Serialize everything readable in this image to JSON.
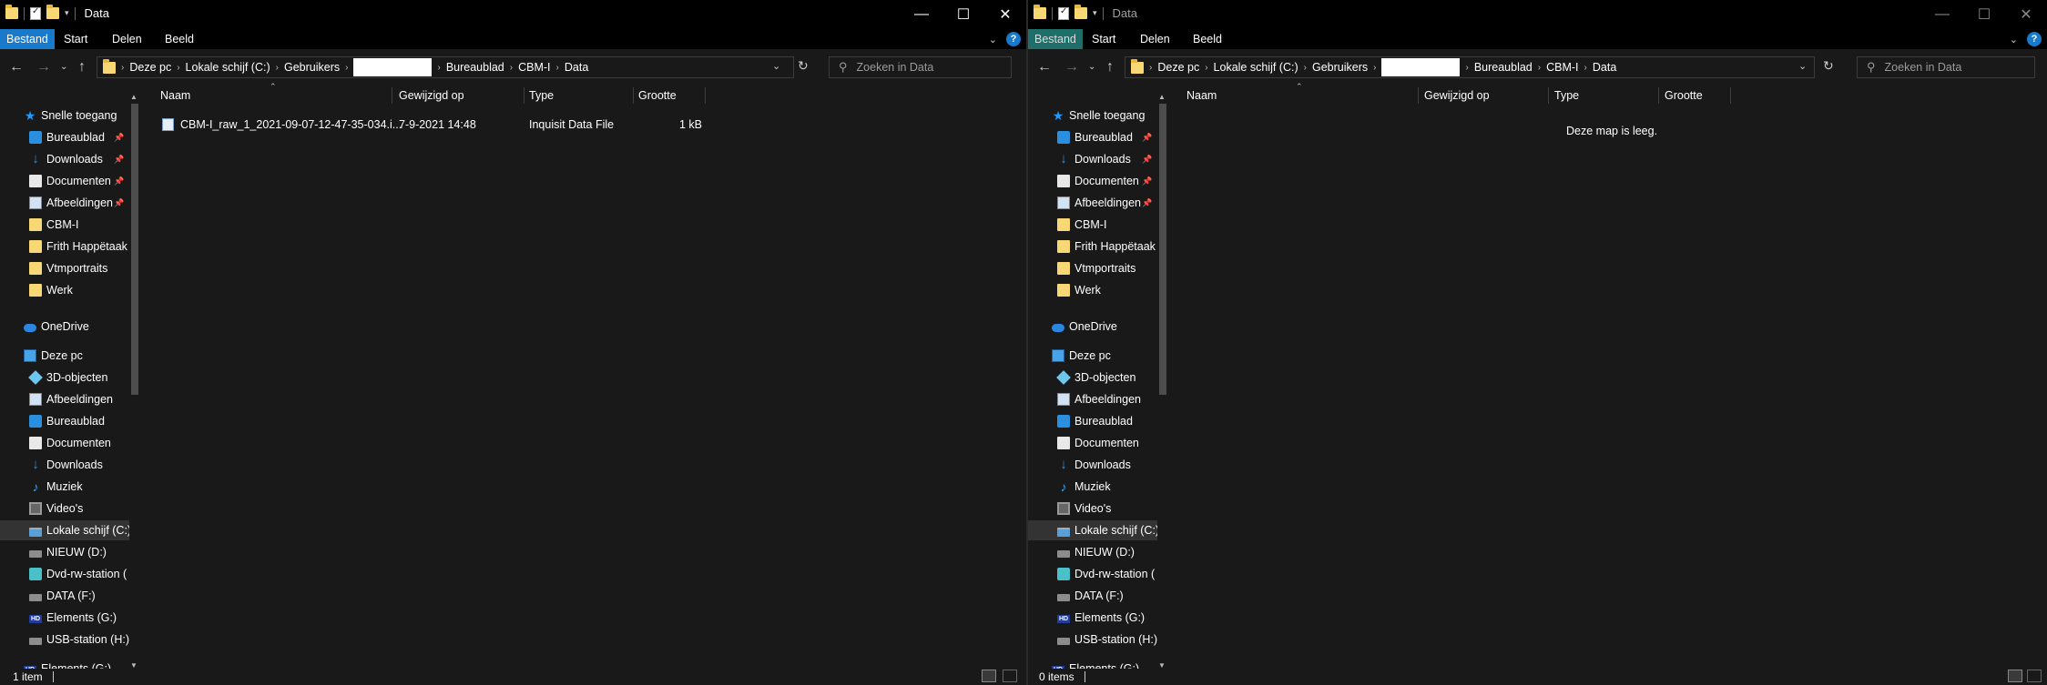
{
  "left": {
    "title": "Data",
    "ribbon_tabs": [
      "Bestand",
      "Start",
      "Delen",
      "Beeld"
    ],
    "breadcrumb": [
      "Deze pc",
      "Lokale schijf (C:)",
      "Gebruikers",
      "Bureaublad",
      "CBM-I",
      "Data"
    ],
    "search_placeholder": "Zoeken in Data",
    "nav": {
      "quick_access": "Snelle toegang",
      "quick_items": [
        "Bureaublad",
        "Downloads",
        "Documenten",
        "Afbeeldingen",
        "CBM-I",
        "Frith Happëtaak",
        "Vtmportraits",
        "Werk"
      ],
      "onedrive": "OneDrive",
      "this_pc": "Deze pc",
      "pc_items": [
        "3D-objecten",
        "Afbeeldingen",
        "Bureaublad",
        "Documenten",
        "Downloads",
        "Muziek",
        "Video's",
        "Lokale schijf (C:)",
        "NIEUW (D:)",
        "Dvd-rw-station (",
        "DATA (F:)",
        "Elements (G:)",
        "USB-station (H:)"
      ],
      "extra_item": "Elements (G:)"
    },
    "columns": [
      "Naam",
      "Gewijzigd op",
      "Type",
      "Grootte"
    ],
    "files": [
      {
        "name": "CBM-I_raw_1_2021-09-07-12-47-35-034.i...",
        "modified": "7-9-2021 14:48",
        "type": "Inquisit Data File",
        "size": "1 kB"
      }
    ],
    "status_count": "1 item"
  },
  "right": {
    "title": "Data",
    "ribbon_tabs": [
      "Bestand",
      "Start",
      "Delen",
      "Beeld"
    ],
    "breadcrumb": [
      "Deze pc",
      "Lokale schijf (C:)",
      "Gebruikers",
      "Bureaublad",
      "CBM-I",
      "Data"
    ],
    "search_placeholder": "Zoeken in Data",
    "nav": {
      "quick_access": "Snelle toegang",
      "quick_items": [
        "Bureaublad",
        "Downloads",
        "Documenten",
        "Afbeeldingen",
        "CBM-I",
        "Frith Happëtaak",
        "Vtmportraits",
        "Werk"
      ],
      "onedrive": "OneDrive",
      "this_pc": "Deze pc",
      "pc_items": [
        "3D-objecten",
        "Afbeeldingen",
        "Bureaublad",
        "Documenten",
        "Downloads",
        "Muziek",
        "Video's",
        "Lokale schijf (C:)",
        "NIEUW (D:)",
        "Dvd-rw-station (",
        "DATA (F:)",
        "Elements (G:)",
        "USB-station (H:)"
      ],
      "extra_item": "Elements (G:)"
    },
    "columns": [
      "Naam",
      "Gewijzigd op",
      "Type",
      "Grootte"
    ],
    "empty_message": "Deze map is leeg.",
    "status_count": "0 items"
  },
  "icons": {
    "minimize": "minimize-icon",
    "maximize": "maximize-icon",
    "close": "close-icon",
    "help": "help-icon"
  }
}
